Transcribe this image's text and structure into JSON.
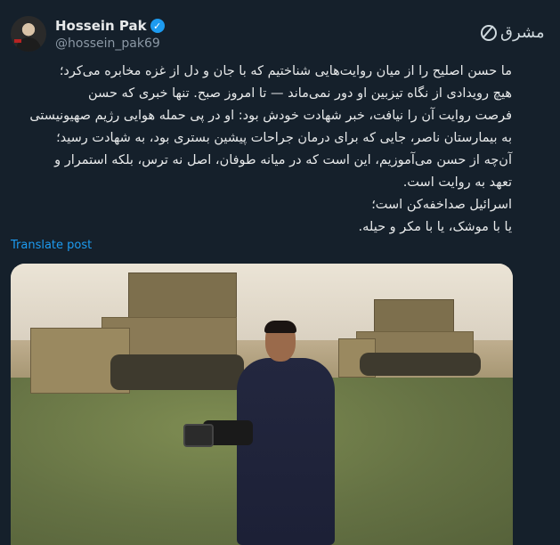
{
  "author": {
    "display_name": "Hossein Pak",
    "handle": "@hossein_pak69",
    "verified_icon": "verified-badge-icon",
    "avatar_icon": "avatar"
  },
  "logo": {
    "text": "مشرق",
    "icon": "mashregh-logo-icon"
  },
  "tweet": {
    "lines": [
      "ما حسن اصلیح را از میان روایت‌هایی شناختیم که با جان و دل از غزه مخابره می‌کرد؛",
      "هیچ رویدادی از نگاه تیزبین او دور نمی‌ماند — تا امروز صبح. تنها خبری که حسن",
      "فرصت روایت آن را نیافت، خبر شهادت خودش بود: او در پی حمله هوایی رژیم صهیونیستی",
      "به بیمارستان ناصر، جایی که برای درمان جراحات پیشین بستری بود، به شهادت رسید؛",
      "آن‌چه از حسن می‌آموزیم، این است که در میانه طوفان، اصل نه ترس، بلکه استمرار و",
      "تعهد به روایت است.",
      "اسرائیل صداخفه‌کن است؛",
      "یا با موشک، یا با مکر و حیله."
    ],
    "translate_label": "Translate post"
  },
  "media": {
    "description_icon": "photo-image"
  },
  "colors": {
    "background": "#15202b",
    "link": "#1d9bf0",
    "verified": "#1d9bf0",
    "secondary_text": "#8b98a5"
  }
}
